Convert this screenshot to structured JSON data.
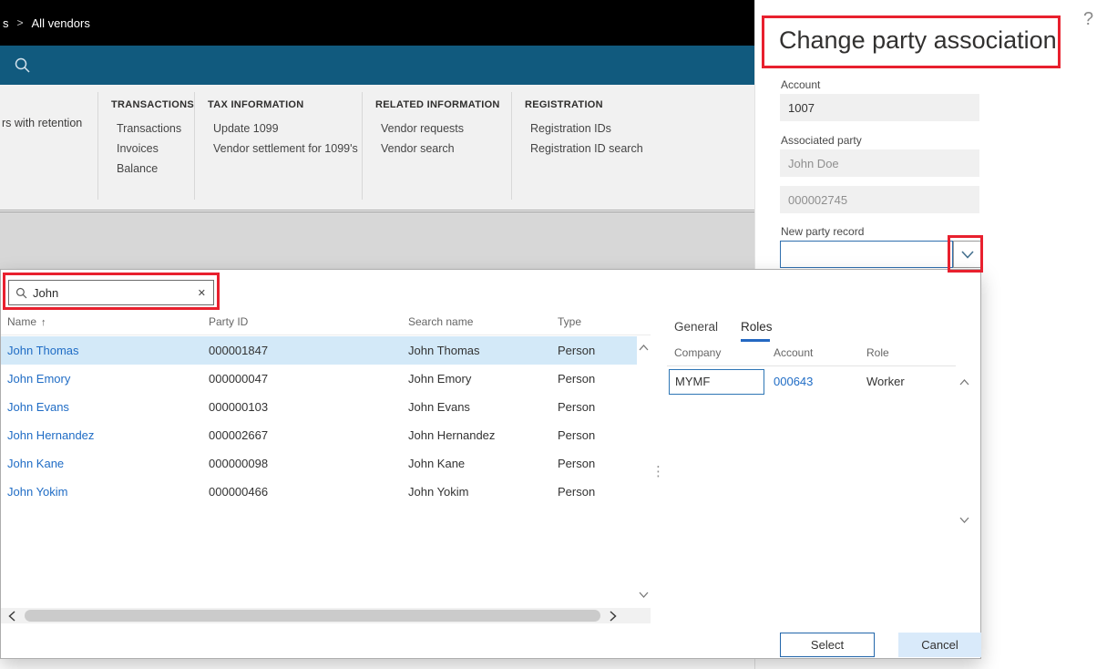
{
  "topbar": {
    "breadcrumb_fragment": "s",
    "breadcrumb": "All vendors"
  },
  "action_pane": {
    "left_fragment": "rs with retention",
    "groups": [
      {
        "title": "TRANSACTIONS",
        "items": [
          "Transactions",
          "Invoices",
          "Balance"
        ]
      },
      {
        "title": "TAX INFORMATION",
        "items": [
          "Update 1099",
          "Vendor settlement for 1099's"
        ]
      },
      {
        "title": "RELATED INFORMATION",
        "items": [
          "Vendor requests",
          "Vendor search"
        ]
      },
      {
        "title": "REGISTRATION",
        "items": [
          "Registration IDs",
          "Registration ID search"
        ]
      }
    ]
  },
  "dialog": {
    "title": "Change party association",
    "account_label": "Account",
    "account_value": "1007",
    "associated_party_label": "Associated party",
    "associated_party_name": "John Doe",
    "associated_party_id": "000002745",
    "new_party_label": "New party record",
    "new_party_value": "",
    "select_label": "Select",
    "cancel_label": "Cancel"
  },
  "lookup": {
    "search_value": "John",
    "columns": {
      "name": "Name",
      "party_id": "Party ID",
      "search_name": "Search name",
      "type": "Type"
    },
    "rows": [
      {
        "name": "John Thomas",
        "party_id": "000001847",
        "search_name": "John Thomas",
        "type": "Person"
      },
      {
        "name": "John Emory",
        "party_id": "000000047",
        "search_name": "John Emory",
        "type": "Person"
      },
      {
        "name": "John Evans",
        "party_id": "000000103",
        "search_name": "John Evans",
        "type": "Person"
      },
      {
        "name": "John Hernandez",
        "party_id": "000002667",
        "search_name": "John Hernandez",
        "type": "Person"
      },
      {
        "name": "John Kane",
        "party_id": "000000098",
        "search_name": "John Kane",
        "type": "Person"
      },
      {
        "name": "John Yokim",
        "party_id": "000000466",
        "search_name": "John Yokim",
        "type": "Person"
      }
    ],
    "detail": {
      "tab_general": "General",
      "tab_roles": "Roles",
      "columns": {
        "company": "Company",
        "account": "Account",
        "role": "Role"
      },
      "row": {
        "company": "MYMF",
        "account": "000643",
        "role": "Worker"
      }
    }
  },
  "icons": {
    "help": "?",
    "clear": "✕",
    "sort_asc": "↑",
    "dots": "⋮",
    "breadcrumb_sep": ">"
  },
  "colors": {
    "navbar": "#115a7e",
    "accent_link": "#1f6cc5",
    "selected_row": "#d3e9f8",
    "annotation_red": "#e8202e",
    "new_party_border": "#2f6fae"
  }
}
